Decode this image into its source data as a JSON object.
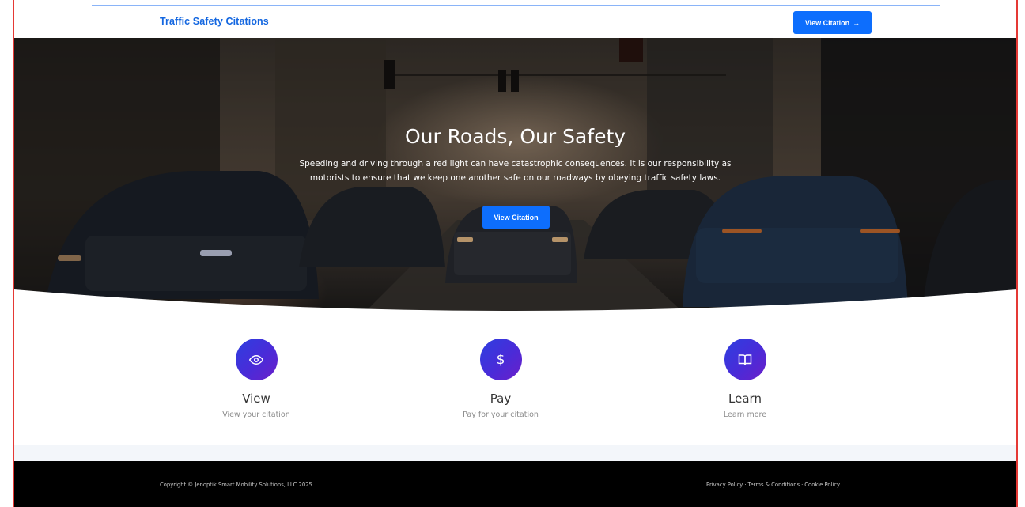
{
  "navbar": {
    "brand": "Traffic Safety Citations",
    "button_label": "View Citation",
    "button_arrow": "→"
  },
  "hero": {
    "title": "Our Roads, Our Safety",
    "text": "Speeding and driving through a red light can have catastrophic consequences. It is our responsibility as motorists to ensure that we keep one another safe on our roadways by obeying traffic safety laws.",
    "button_label": "View Citation"
  },
  "features": [
    {
      "icon": "eye-icon",
      "title": "View",
      "description": "View your citation"
    },
    {
      "icon": "dollar-icon",
      "title": "Pay",
      "description": "Pay for your citation"
    },
    {
      "icon": "book-icon",
      "title": "Learn",
      "description": "Learn more"
    }
  ],
  "footer": {
    "copyright": "Copyright © Jenoptik Smart Mobility Solutions, LLC 2025",
    "links": [
      "Privacy Policy",
      "Terms & Conditions",
      "Cookie Policy"
    ],
    "separator": "·"
  },
  "colors": {
    "brand_blue": "#1467e0",
    "button_blue": "#0d6efd",
    "icon_gradient_start": "#2d3fe0",
    "icon_gradient_end": "#6b1fc9",
    "footer_bg": "#000000",
    "frame_border": "#e53935"
  }
}
